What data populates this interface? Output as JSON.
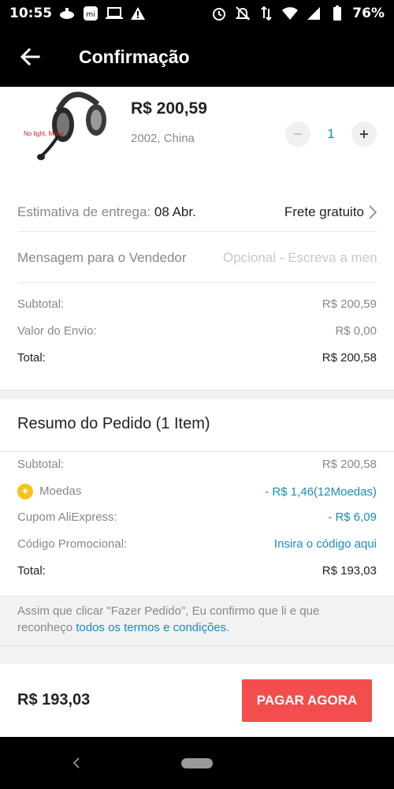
{
  "status_bar": {
    "time": "10:55",
    "battery": "76%"
  },
  "header": {
    "title": "Confirmação"
  },
  "product": {
    "thumb_text": "No light, Metal",
    "price": "R$ 200,59",
    "variant": "2002, China",
    "quantity": "1"
  },
  "delivery": {
    "label": "Estimativa de entrega:",
    "date": "08 Abr.",
    "shipping": "Frete gratuito"
  },
  "message": {
    "label": "Mensagem para o Vendedor",
    "placeholder": "Opcional - Escreva a mensagem"
  },
  "store_summary": {
    "subtotal_label": "Subtotal:",
    "subtotal_value": "R$ 200,59",
    "shipping_label": "Valor do Envio:",
    "shipping_value": "R$ 0,00",
    "total_label": "Total:",
    "total_value": "R$ 200,58"
  },
  "order_summary": {
    "title": "Resumo do Pedido (1 Item)",
    "subtotal_label": "Subtotal:",
    "subtotal_value": "R$ 200,58",
    "coins_label": "Moedas",
    "coins_value": "- R$ 1,46(12Moedas)",
    "coupon_label": "Cupom AliExpress:",
    "coupon_value": "- R$ 6,09",
    "promo_label": "Código Promocional:",
    "promo_value": "Insira o código aqui",
    "total_label": "Total:",
    "total_value": "R$ 193,03"
  },
  "terms": {
    "text": "Assim que clicar \"Fazer Pedido\", Eu confirmo que li e que reconheço ",
    "link": "todos os termos e condições",
    "end": "."
  },
  "footer": {
    "total": "R$ 193,03",
    "pay_label": "PAGAR AGORA"
  },
  "colors": {
    "accent_blue": "#1a8cbd",
    "pay_button": "#f44d4d",
    "coin": "#f7c21b"
  }
}
